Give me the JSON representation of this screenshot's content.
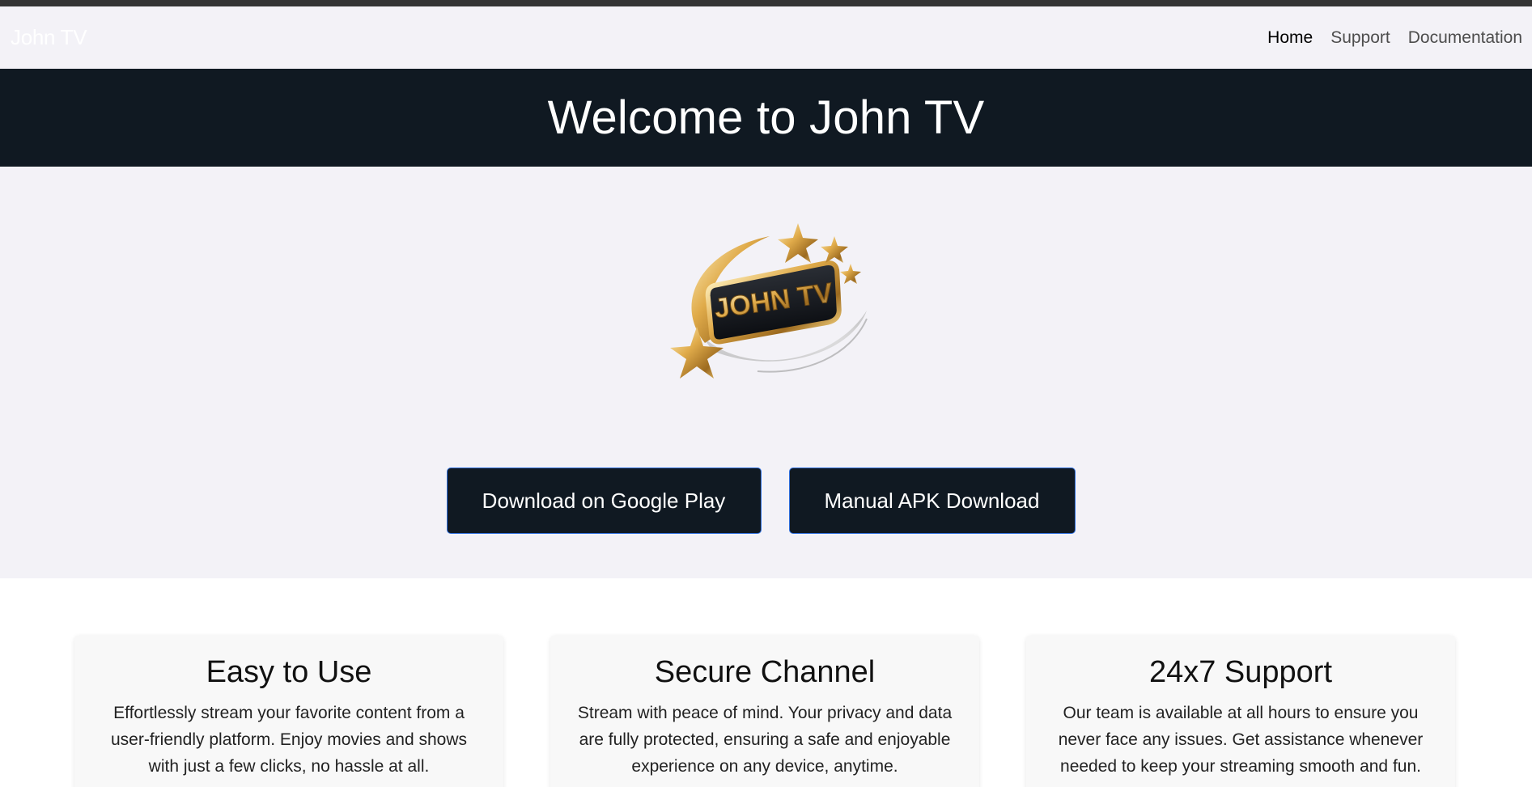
{
  "navbar": {
    "brand": "John TV",
    "links": [
      {
        "label": "Home",
        "active": true
      },
      {
        "label": "Support",
        "active": false
      },
      {
        "label": "Documentation",
        "active": false
      }
    ]
  },
  "hero": {
    "title": "Welcome to John TV",
    "logo_text": "JOHN TV",
    "buttons": {
      "google_play": "Download on Google Play",
      "apk": "Manual APK Download"
    }
  },
  "features": [
    {
      "title": "Easy to Use",
      "text": "Effortlessly stream your favorite content from a user-friendly platform. Enjoy movies and shows with just a few clicks, no hassle at all."
    },
    {
      "title": "Secure Channel",
      "text": "Stream with peace of mind. Your privacy and data are fully protected, ensuring a safe and enjoyable experience on any device, anytime."
    },
    {
      "title": "24x7 Support",
      "text": "Our team is available at all hours to ensure you never face any issues. Get assistance whenever needed to keep your streaming smooth and fun."
    }
  ],
  "colors": {
    "dark": "#101922",
    "light_bg": "#f3f2f7",
    "button_border": "#2f6fdd",
    "gold": "#d9a441"
  }
}
